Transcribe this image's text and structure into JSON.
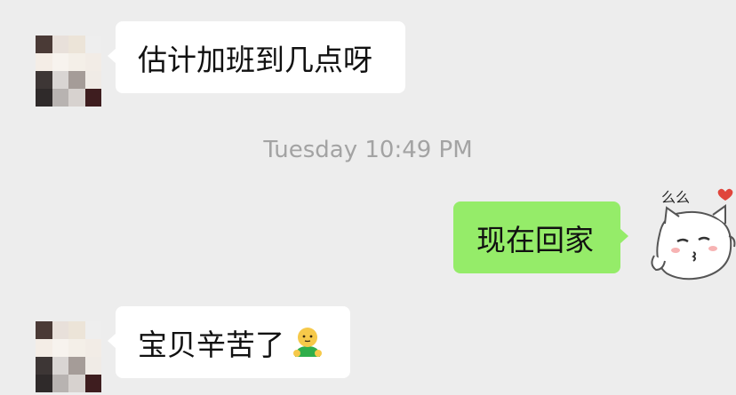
{
  "messages": [
    {
      "sender": "contact",
      "text": "估计加班到几点呀"
    },
    {
      "sender": "self",
      "text": "现在回家"
    },
    {
      "sender": "contact",
      "text": "宝贝辛苦了",
      "emoji": "face-with-green-body-emoji"
    }
  ],
  "timestamp": "Tuesday 10:49 PM",
  "sticker_avatar": {
    "text": "么么",
    "icon": "kissing-cat-sticker"
  },
  "colors": {
    "background": "#ededed",
    "incoming_bubble": "#ffffff",
    "outgoing_bubble": "#95ec69",
    "timestamp_text": "#a3a3a3"
  }
}
